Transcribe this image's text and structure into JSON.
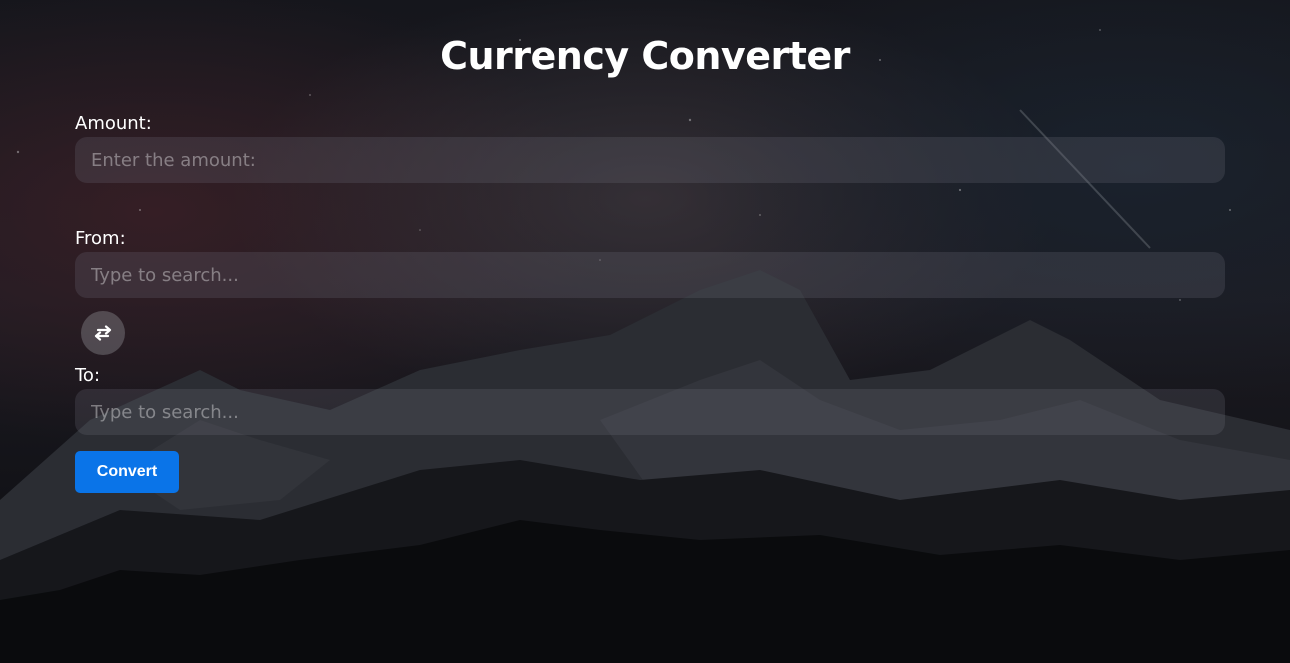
{
  "header": {
    "title": "Currency Converter"
  },
  "form": {
    "amount": {
      "label": "Amount:",
      "placeholder": "Enter the amount:",
      "value": ""
    },
    "from": {
      "label": "From:",
      "placeholder": "Type to search...",
      "value": ""
    },
    "swap": {
      "icon": "swap-arrows-icon"
    },
    "to": {
      "label": "To:",
      "placeholder": "Type to search...",
      "value": ""
    },
    "convert_label": "Convert"
  },
  "colors": {
    "accent": "#0a74e8",
    "text": "#ffffff",
    "background": "#0b0c10"
  }
}
